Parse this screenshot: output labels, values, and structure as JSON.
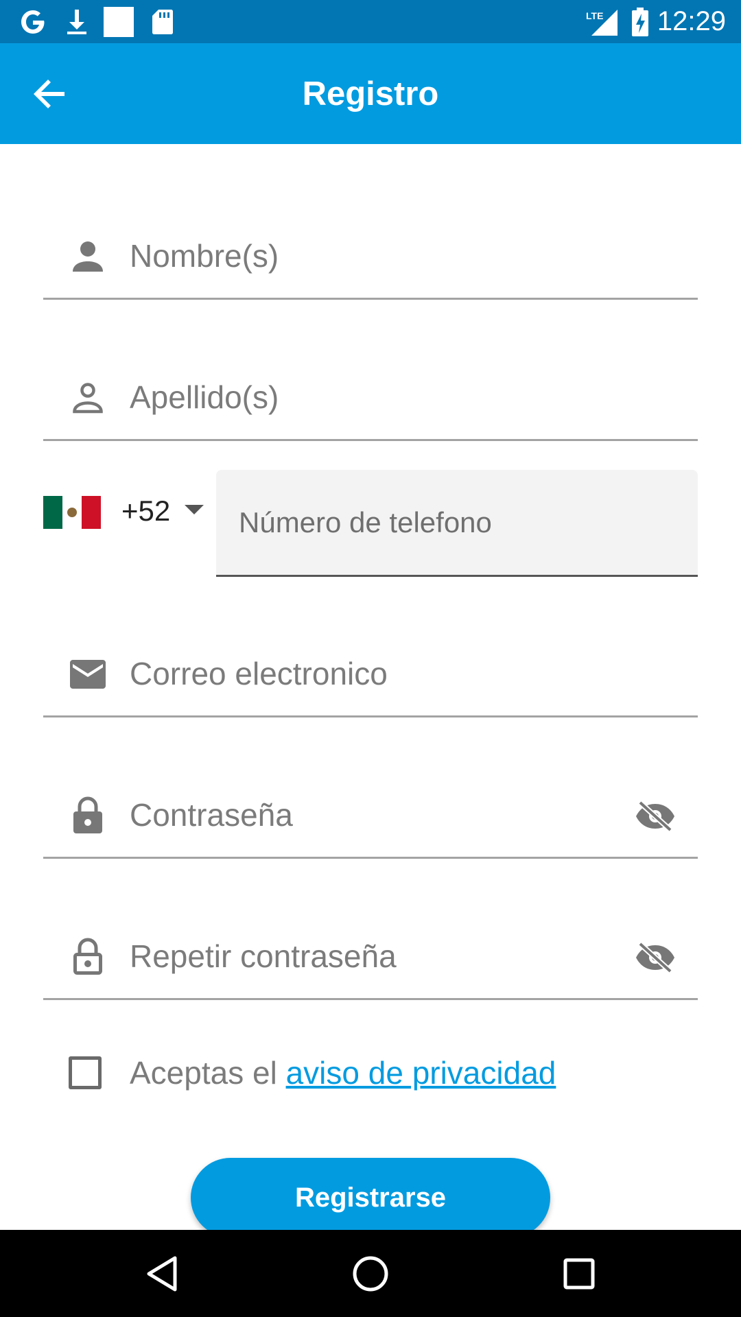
{
  "status_bar": {
    "time": "12:29",
    "icons": [
      "google-icon",
      "download-icon",
      "blank-square-icon",
      "sd-card-icon",
      "lte-signal-icon",
      "battery-charging-icon"
    ],
    "network_label": "LTE"
  },
  "app_bar": {
    "title": "Registro",
    "back_icon": "arrow-back-icon"
  },
  "form": {
    "first_name": {
      "placeholder": "Nombre(s)",
      "icon": "person-filled-icon"
    },
    "last_name": {
      "placeholder": "Apellido(s)",
      "icon": "person-outline-icon"
    },
    "phone": {
      "country_flag": "mexico-flag-icon",
      "dial_code": "+52",
      "placeholder": "Número de telefono"
    },
    "email": {
      "placeholder": "Correo electronico",
      "icon": "mail-icon"
    },
    "password": {
      "placeholder": "Contraseña",
      "icon": "lock-filled-icon",
      "toggle_icon": "eye-off-icon"
    },
    "repeat_password": {
      "placeholder": "Repetir contraseña",
      "icon": "lock-outline-icon",
      "toggle_icon": "eye-off-icon"
    },
    "privacy": {
      "prefix": "Aceptas el ",
      "link_text": "aviso de privacidad",
      "checked": false
    },
    "submit_label": "Registrarse"
  },
  "colors": {
    "status_bar": "#0276B3",
    "primary": "#039BE0",
    "placeholder_text": "#7b7b7b",
    "underline": "#a3a3a3",
    "nav_bar": "#000000"
  },
  "nav_bar": {
    "buttons": [
      "back-triangle-icon",
      "home-circle-icon",
      "recents-square-icon"
    ]
  }
}
